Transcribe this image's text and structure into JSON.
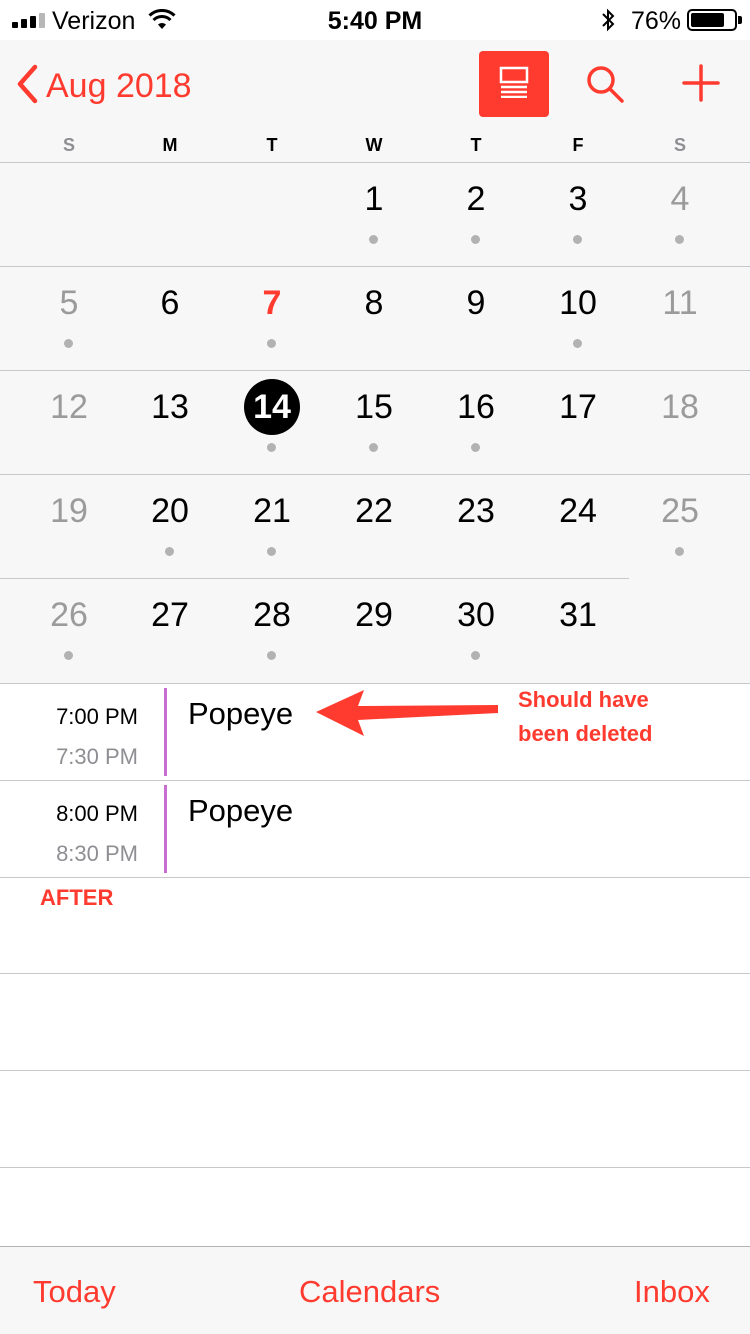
{
  "status_bar": {
    "carrier": "Verizon",
    "time": "5:40 PM",
    "battery": "76%",
    "battery_level": 0.76
  },
  "nav": {
    "back_label": "Aug 2018",
    "accent_color": "#ff3b30",
    "icons": [
      "chevron-left-icon",
      "list-view-icon",
      "search-icon",
      "plus-icon"
    ]
  },
  "weekdays": [
    "S",
    "M",
    "T",
    "W",
    "T",
    "F",
    "S"
  ],
  "month": {
    "today": "7",
    "selected": "14",
    "weeks": [
      [
        {
          "day": "",
          "dot": false
        },
        {
          "day": "",
          "dot": false
        },
        {
          "day": "",
          "dot": false
        },
        {
          "day": "1",
          "dot": true
        },
        {
          "day": "2",
          "dot": true
        },
        {
          "day": "3",
          "dot": true
        },
        {
          "day": "4",
          "dot": true
        }
      ],
      [
        {
          "day": "5",
          "dot": true
        },
        {
          "day": "6",
          "dot": false
        },
        {
          "day": "7",
          "dot": true
        },
        {
          "day": "8",
          "dot": false
        },
        {
          "day": "9",
          "dot": false
        },
        {
          "day": "10",
          "dot": true
        },
        {
          "day": "11",
          "dot": false
        }
      ],
      [
        {
          "day": "12",
          "dot": false
        },
        {
          "day": "13",
          "dot": false
        },
        {
          "day": "14",
          "dot": true
        },
        {
          "day": "15",
          "dot": true
        },
        {
          "day": "16",
          "dot": true
        },
        {
          "day": "17",
          "dot": false
        },
        {
          "day": "18",
          "dot": false
        }
      ],
      [
        {
          "day": "19",
          "dot": false
        },
        {
          "day": "20",
          "dot": true
        },
        {
          "day": "21",
          "dot": true
        },
        {
          "day": "22",
          "dot": false
        },
        {
          "day": "23",
          "dot": false
        },
        {
          "day": "24",
          "dot": false
        },
        {
          "day": "25",
          "dot": true
        }
      ],
      [
        {
          "day": "26",
          "dot": true
        },
        {
          "day": "27",
          "dot": false
        },
        {
          "day": "28",
          "dot": true
        },
        {
          "day": "29",
          "dot": false
        },
        {
          "day": "30",
          "dot": true
        },
        {
          "day": "31",
          "dot": false
        },
        {
          "day": "",
          "dot": false
        }
      ]
    ]
  },
  "events": [
    {
      "start": "7:00 PM",
      "end": "7:30 PM",
      "title": "Popeye",
      "color": "#c86ed1"
    },
    {
      "start": "8:00 PM",
      "end": "8:30 PM",
      "title": "Popeye",
      "color": "#c86ed1"
    }
  ],
  "annotations": {
    "note_line1": "Should have",
    "note_line2": "been deleted",
    "after_label": "AFTER",
    "color": "#ff3b30"
  },
  "tab_bar": {
    "today": "Today",
    "calendars": "Calendars",
    "inbox": "Inbox"
  }
}
